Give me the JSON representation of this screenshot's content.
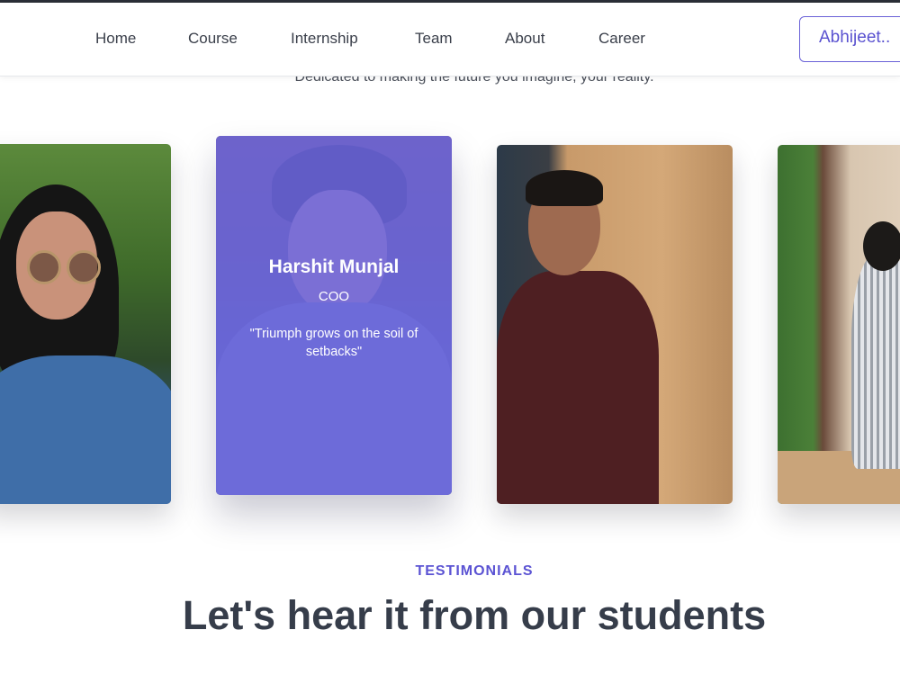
{
  "nav": {
    "items": [
      "Home",
      "Course",
      "Internship",
      "Team",
      "About",
      "Career"
    ],
    "user_button": "Abhijeet.."
  },
  "team": {
    "tagline": "Dedicated to making the future you imagine, your reality.",
    "featured": {
      "name": "Harshit Munjal",
      "role": "COO",
      "quote": "\"Triumph grows on the soil of setbacks\""
    }
  },
  "testimonials": {
    "label": "TESTIMONIALS",
    "title": "Let's hear it from our students"
  },
  "colors": {
    "accent": "#5b53d3",
    "overlay": "#6e69eb",
    "heading": "#363d4a"
  }
}
